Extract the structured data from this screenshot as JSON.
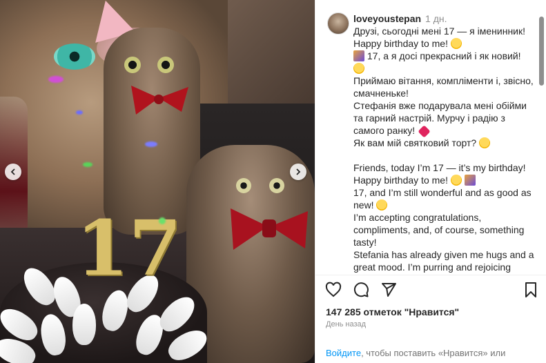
{
  "post": {
    "username": "loveyoustepan",
    "time_ago": "1 дн.",
    "caption_ua": [
      "Друзі, сьогодні мені 17 — я іменинник! Happy birthday to me!",
      "17, а я досі прекрасний і як новий!",
      "Приймаю вітання, компліменти і, звісно, смачненьке!",
      "Стефанія вже подарувала мені обійми та гарний настрій. Мурчу і радію з самого ранку!",
      "Як вам мій святковий торт?"
    ],
    "caption_en": [
      "Friends, today I’m 17 — it’s my birthday! Happy birthday to me!",
      "17, and I’m still wonderful and as good as new!",
      "I’m accepting congratulations, compliments, and, of course, something tasty!",
      "Stefania has already given me hugs and a great mood. I’m purring and rejoicing"
    ],
    "likes": "147 285 отметок \"Нравится\"",
    "posted_label": "День назад",
    "login_link": "Войдите",
    "login_rest": ", чтобы поставить «Нравится» или"
  },
  "photo": {
    "candle_number": "17"
  },
  "icons": {
    "like": "heart-icon",
    "comment": "comment-icon",
    "share": "share-icon",
    "save": "bookmark-icon",
    "prev": "chevron-left-icon",
    "next": "chevron-right-icon"
  },
  "colors": {
    "link": "#0095f6",
    "muted": "#8e8e8e",
    "text": "#262626"
  }
}
